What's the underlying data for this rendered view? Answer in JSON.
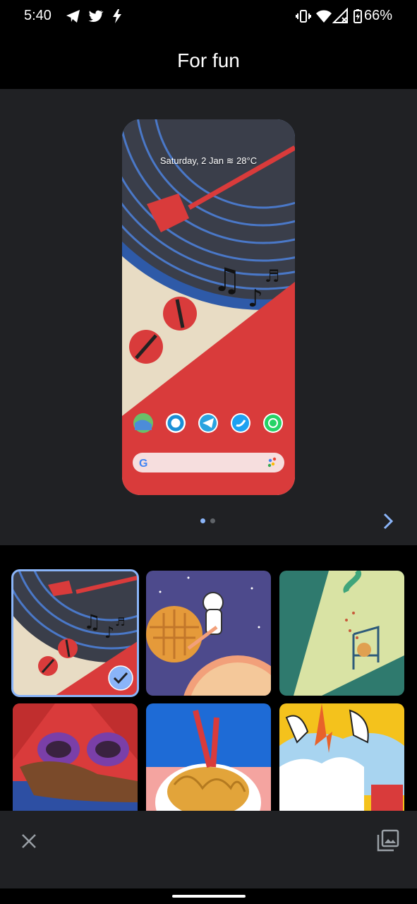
{
  "status_bar": {
    "time": "5:40",
    "battery_percent": "66%",
    "left_icons": [
      "telegram-icon",
      "twitter-icon",
      "bolt-icon"
    ],
    "right_icons": [
      "vibrate-icon",
      "wifi-icon",
      "signal-icon",
      "battery-icon"
    ]
  },
  "header": {
    "title": "For fun"
  },
  "preview": {
    "date_weather": "Saturday, 2 Jan  ≋ 28°C",
    "dock_icons": [
      "maps-icon",
      "edge-icon",
      "telegram-icon",
      "twitter-icon",
      "whatsapp-icon"
    ],
    "search_bar_icons": [
      "google-g-icon",
      "assistant-dots-icon"
    ],
    "page_count": 2,
    "current_page": 1,
    "next_icon": "chevron-right-icon"
  },
  "gallery": {
    "items": [
      {
        "name": "record-player",
        "selected": true
      },
      {
        "name": "astronaut-waffle",
        "selected": false
      },
      {
        "name": "chair-spotlight",
        "selected": false
      },
      {
        "name": "sunglasses-arms",
        "selected": false
      },
      {
        "name": "pencil-noodles",
        "selected": false
      },
      {
        "name": "hands-clouds",
        "selected": false
      }
    ],
    "selected_icon": "check-icon"
  },
  "bottom_bar": {
    "close_icon": "close-icon",
    "gallery_icon": "image-gallery-icon"
  },
  "colors": {
    "accent": "#8ab4f8",
    "surface": "#202124",
    "record_blue": "#2e5aa8",
    "record_red": "#d93b3b",
    "record_cream": "#e8dcc4"
  }
}
